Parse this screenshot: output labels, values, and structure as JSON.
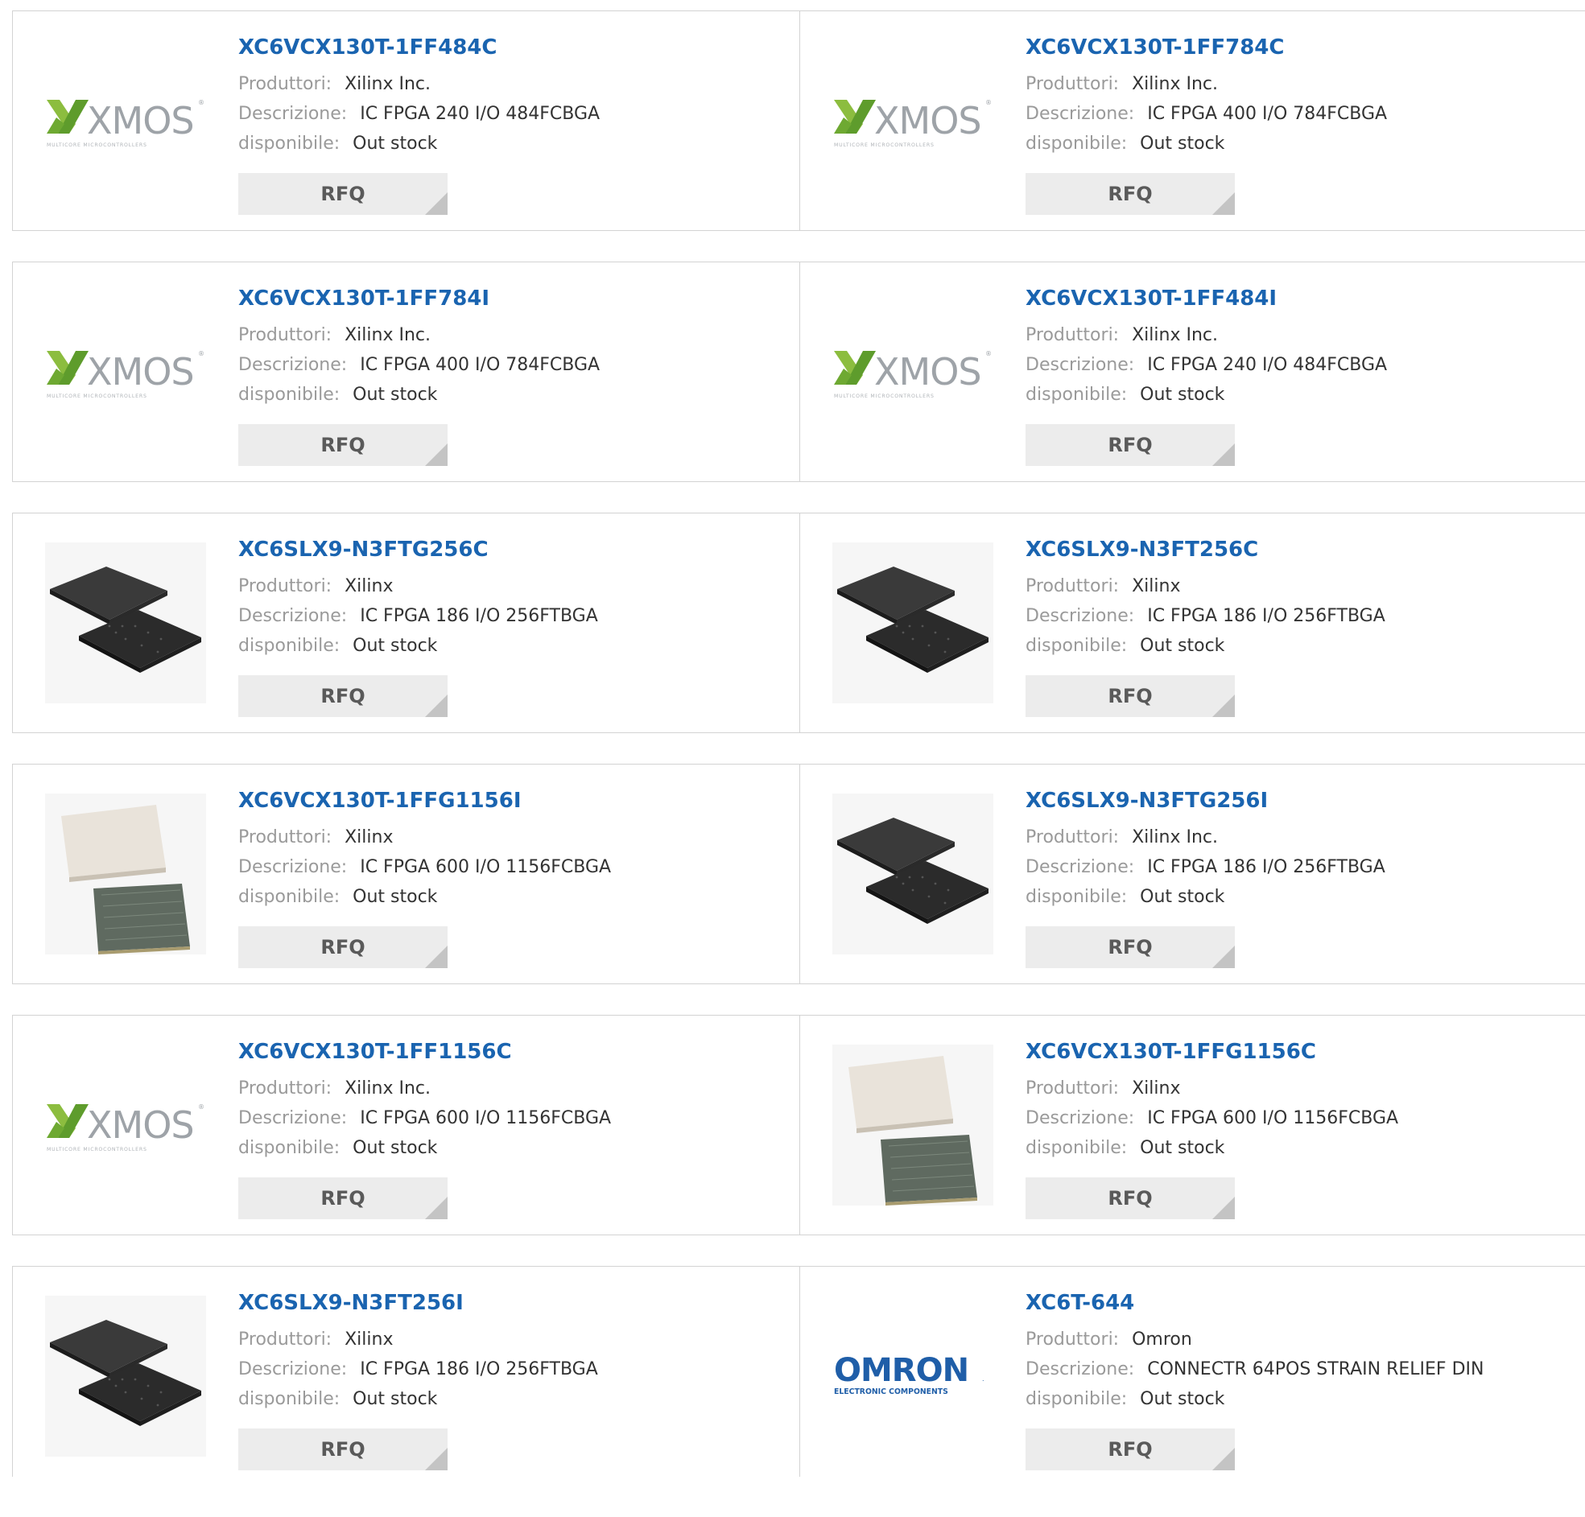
{
  "labels": {
    "producer": "Produttori:",
    "description": "Descrizione:",
    "availability": "disponibile:",
    "rfq_button": "RFQ"
  },
  "logo_text": {
    "xmos_main": "XMOS",
    "xmos_sub": "MULTICORE MICROCONTROLLERS",
    "omron_main": "OMRON",
    "omron_sub": "ELECTRONIC COMPONENTS"
  },
  "colors": {
    "part_link": "#1a64b0",
    "label_gray": "#9a9a9a",
    "value_text": "#333333",
    "button_bg": "#ececec",
    "xmos_green": "#8cbd3f",
    "omron_blue": "#1f5ea8"
  },
  "products": [
    {
      "part": "XC6VCX130T-1FF484C",
      "producer": "Xilinx Inc.",
      "description": "IC FPGA 240 I/O 484FCBGA",
      "availability": "Out stock",
      "image": "xmos-logo"
    },
    {
      "part": "XC6VCX130T-1FF784C",
      "producer": "Xilinx Inc.",
      "description": "IC FPGA 400 I/O 784FCBGA",
      "availability": "Out stock",
      "image": "xmos-logo"
    },
    {
      "part": "XC6VCX130T-1FF784I",
      "producer": "Xilinx Inc.",
      "description": "IC FPGA 400 I/O 784FCBGA",
      "availability": "Out stock",
      "image": "xmos-logo"
    },
    {
      "part": "XC6VCX130T-1FF484I",
      "producer": "Xilinx Inc.",
      "description": "IC FPGA 240 I/O 484FCBGA",
      "availability": "Out stock",
      "image": "xmos-logo"
    },
    {
      "part": "XC6SLX9-N3FTG256C",
      "producer": "Xilinx",
      "description": "IC FPGA 186 I/O 256FTBGA",
      "availability": "Out stock",
      "image": "black-bga-chip"
    },
    {
      "part": "XC6SLX9-N3FT256C",
      "producer": "Xilinx",
      "description": "IC FPGA 186 I/O 256FTBGA",
      "availability": "Out stock",
      "image": "black-bga-chip"
    },
    {
      "part": "XC6VCX130T-1FFG1156I",
      "producer": "Xilinx",
      "description": "IC FPGA 600 I/O 1156FCBGA",
      "availability": "Out stock",
      "image": "ceramic-bga-chip"
    },
    {
      "part": "XC6SLX9-N3FTG256I",
      "producer": "Xilinx Inc.",
      "description": "IC FPGA 186 I/O 256FTBGA",
      "availability": "Out stock",
      "image": "black-bga-chip"
    },
    {
      "part": "XC6VCX130T-1FF1156C",
      "producer": "Xilinx Inc.",
      "description": "IC FPGA 600 I/O 1156FCBGA",
      "availability": "Out stock",
      "image": "xmos-logo"
    },
    {
      "part": "XC6VCX130T-1FFG1156C",
      "producer": "Xilinx",
      "description": "IC FPGA 600 I/O 1156FCBGA",
      "availability": "Out stock",
      "image": "ceramic-bga-chip"
    },
    {
      "part": "XC6SLX9-N3FT256I",
      "producer": "Xilinx",
      "description": "IC FPGA 186 I/O 256FTBGA",
      "availability": "Out stock",
      "image": "black-bga-chip"
    },
    {
      "part": "XC6T-644",
      "producer": "Omron",
      "description": "CONNECTR 64POS STRAIN RELIEF DIN",
      "availability": "Out stock",
      "image": "omron-logo"
    }
  ]
}
